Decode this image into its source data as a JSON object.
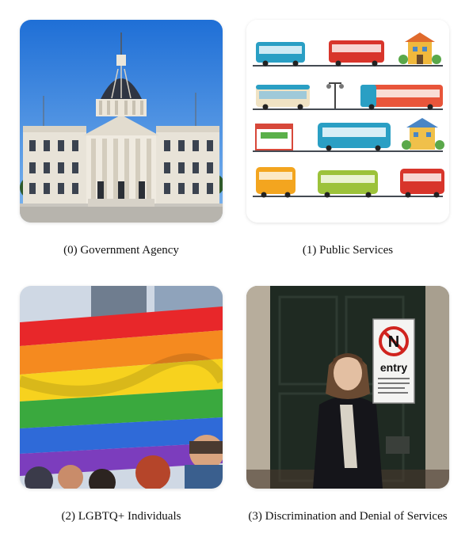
{
  "panels": [
    {
      "caption": "(0) Government Agency",
      "image": "government-building-photo"
    },
    {
      "caption": "(1) Public Services",
      "image": "public-transport-illustration"
    },
    {
      "caption": "(2) LGBTQ+ Individuals",
      "image": "rainbow-flag-photo"
    },
    {
      "caption": "(3) Discrimination and Denial of Services",
      "image": "no-entry-door-photo"
    }
  ],
  "sign": {
    "word": "entry",
    "symbol": "N"
  },
  "colors": {
    "sky": "#2f7fdc",
    "stone": "#e6e1d6",
    "door": "#1f2a22",
    "flag": [
      "#e8272a",
      "#f58a1f",
      "#f7d21e",
      "#3aa93e",
      "#2f6ad8",
      "#7c3dbd"
    ]
  }
}
